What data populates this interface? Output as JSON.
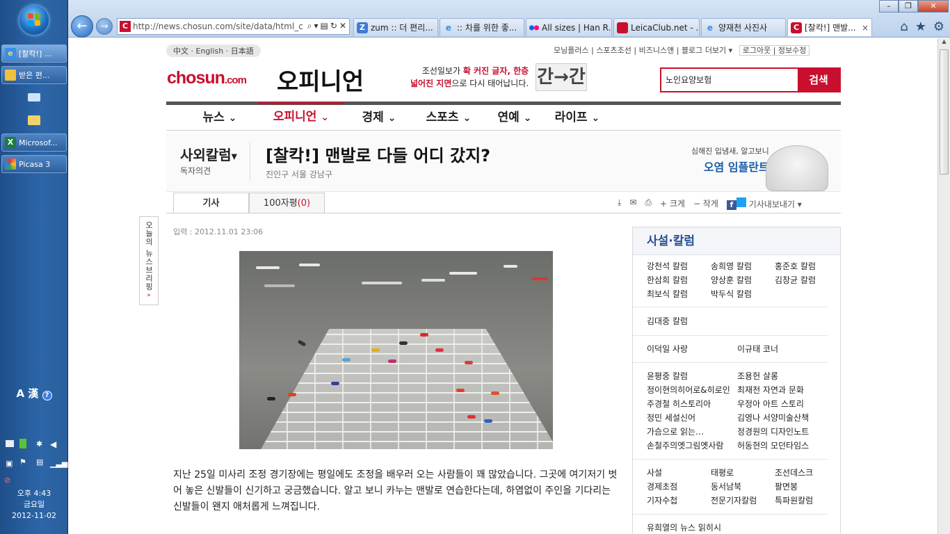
{
  "taskbar": {
    "buttons": [
      {
        "label": "[찰칵!] ..."
      },
      {
        "label": "받은 편..."
      },
      {
        "label": "Microsof..."
      },
      {
        "label": "Picasa 3"
      }
    ],
    "ime": "A 漢",
    "clock": {
      "time": "오후 4:43",
      "day": "금요일",
      "date": "2012-11-02"
    }
  },
  "browser": {
    "address": "http://news.chosun.com/site/data/html_c",
    "address_favicon": "C",
    "tabs": [
      {
        "label": "zum :: 더 편리...",
        "icon": "zum-icon",
        "active": false
      },
      {
        "label": ":: 차를 위한 좋...",
        "icon": "ie-icon",
        "active": false
      },
      {
        "label": "All sizes | Han R...",
        "icon": "flickr-icon",
        "active": false
      },
      {
        "label": "LeicaClub.net - ...",
        "icon": "leica-icon",
        "active": false
      },
      {
        "label": "양재천 사진사",
        "icon": "ie-icon",
        "active": false
      },
      {
        "label": "[찰칵!] 맨발...",
        "icon": "chosun-icon",
        "active": true
      }
    ],
    "tab_close": "×"
  },
  "site": {
    "langs": "中文 · English · 日本語",
    "toplinks": [
      "모닝플러스",
      "스포츠조선",
      "비즈니스앤",
      "블로그",
      "더보기 ▾"
    ],
    "login": "로그아웃",
    "profile": "정보수정",
    "logo": "chosun",
    "logo_suffix": ".com",
    "section": "오피니언",
    "promo_line1": "조선일보가 ",
    "promo_line1_b": "확 커진 글자, 한층",
    "promo_line2_b": "넓어진 지면",
    "promo_line2": "으로 다시 태어납니다.",
    "promo_logo": "간→간",
    "search_value": "노인요양보험",
    "search_button": "검색",
    "gnb": [
      "뉴스",
      "오피니언",
      "경제",
      "스포츠",
      "연예",
      "라이프"
    ],
    "category": "사외칼럼",
    "category_sub": "독자의견",
    "title": "[찰칵!] 맨발로 다들 어디 갔지?",
    "author": "진인구 서울 강남구",
    "ad_line1": "심해진 입냄새, 알고보니",
    "ad_line2": "오염 임플란트",
    "tab_article": "기사",
    "tab_comments": "100자평",
    "tab_comment_count": "(0)",
    "tools": [
      "+ 크게",
      "− 작게",
      "기사내보내기 ▾"
    ],
    "brief": "오늘의 뉴스브리핑",
    "date": "입력 : 2012.11.01 23:06",
    "body": "지난 25일 미사리 조정 경기장에는 평일에도 조정을 배우러 오는 사람들이 꽤 많았습니다. 그곳에 여기저기 벗어 놓은 신발들이 신기하고 궁금했습니다. 알고 보니 카누는 맨발로 연습한다는데, 하염없이 주인을 기다리는 신발들이 왠지 애처롭게 느껴집니다."
  },
  "sidebar": {
    "title": "사설·칼럼",
    "group1": [
      "강천석 칼럼",
      "송희영 칼럼",
      "홍준호 칼럼",
      "한삼희 칼럼",
      "양상훈 칼럼",
      "김창균 칼럼",
      "최보식 칼럼",
      "박두식 칼럼"
    ],
    "group2": [
      "김대중 칼럼"
    ],
    "group3": [
      "이덕일 사랑",
      "이규태 코너"
    ],
    "group4": [
      "윤평중 칼럼",
      "조용헌 살롱",
      "정이현의히어로&히로인",
      "최재천 자연과 문화",
      "주경철 히스토리아",
      "우정아 아트 스토리",
      "정민 세설신어",
      "김영나 서양미술산책",
      "가슴으로 읽는…",
      "정경원의 디자인노트",
      "손철주의옛그림옛사람",
      "허동현의 모던타임스"
    ],
    "group5": [
      "사설",
      "태평로",
      "조선데스크",
      "경제초점",
      "동서남북",
      "팔면봉",
      "기자수첩",
      "전문기자칼럼",
      "특파원칼럼"
    ],
    "group6": [
      "유희열의 뉴스 읽히시"
    ]
  }
}
